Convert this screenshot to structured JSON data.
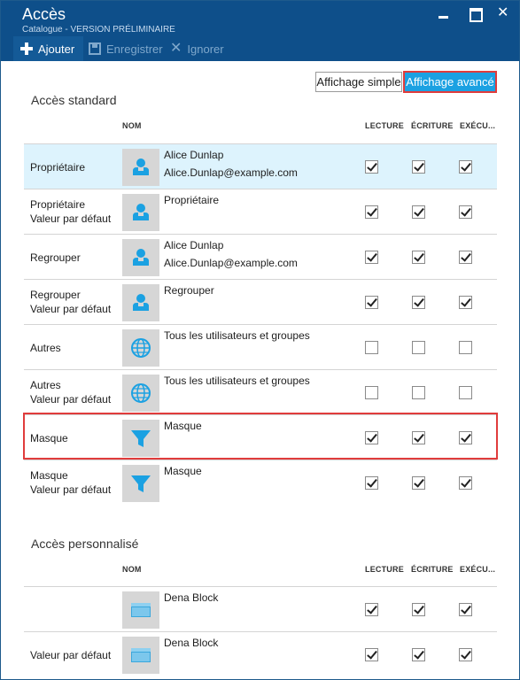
{
  "window": {
    "title": "Accès",
    "subtitle": "Catalogue - VERSION PRÉLIMINAIRE"
  },
  "toolbar": {
    "add_label": "Ajouter",
    "save_label": "Enregistrer",
    "ignore_label": "Ignorer"
  },
  "view_switch": {
    "simple": "Affichage simple",
    "advanced": "Affichage avancé"
  },
  "columns": {
    "name": "NOM",
    "read": "LECTURE",
    "write": "ÉCRITURE",
    "exec": "EXÉCU..."
  },
  "standard": {
    "title": "Accès standard",
    "rows": [
      {
        "label1": "Propriétaire",
        "label2": "",
        "icon": "user-icon",
        "name1": "Alice Dunlap",
        "name2": "Alice.Dunlap@example.com",
        "read": true,
        "write": true,
        "exec": true,
        "selected": true
      },
      {
        "label1": "Propriétaire",
        "label2": "Valeur par défaut",
        "icon": "user-icon",
        "name1": "Propriétaire",
        "name2": "",
        "read": true,
        "write": true,
        "exec": true
      },
      {
        "label1": "Regrouper",
        "label2": "",
        "icon": "user-icon",
        "name1": "Alice Dunlap",
        "name2": "Alice.Dunlap@example.com",
        "read": true,
        "write": true,
        "exec": true
      },
      {
        "label1": "Regrouper",
        "label2": "Valeur par défaut",
        "icon": "user-icon",
        "name1": "Regrouper",
        "name2": "",
        "read": true,
        "write": true,
        "exec": true
      },
      {
        "label1": "Autres",
        "label2": "",
        "icon": "globe-icon",
        "name1": "Tous les utilisateurs et groupes",
        "name2": "",
        "read": false,
        "write": false,
        "exec": false
      },
      {
        "label1": "Autres",
        "label2": "Valeur par défaut",
        "icon": "globe-icon",
        "name1": "Tous les utilisateurs et groupes",
        "name2": "",
        "read": false,
        "write": false,
        "exec": false
      },
      {
        "label1": "Masque",
        "label2": "",
        "icon": "filter-icon",
        "name1": "Masque",
        "name2": "",
        "read": true,
        "write": true,
        "exec": true
      },
      {
        "label1": "Masque",
        "label2": "Valeur par défaut",
        "icon": "filter-icon",
        "name1": "Masque",
        "name2": "",
        "read": true,
        "write": true,
        "exec": true
      }
    ]
  },
  "custom": {
    "title": "Accès personnalisé",
    "rows": [
      {
        "label1": "",
        "label2": "",
        "icon": "window-icon",
        "name1": "Dena Block",
        "name2": "",
        "read": true,
        "write": true,
        "exec": true
      },
      {
        "label1": "Valeur par défaut",
        "label2": "",
        "icon": "window-icon",
        "name1": "Dena Block",
        "name2": "",
        "read": true,
        "write": true,
        "exec": true
      }
    ]
  },
  "colors": {
    "header": "#0e4f8a",
    "accent": "#1ba1e2",
    "selected_row": "#ddf3fd",
    "highlight": "#e03c3c"
  }
}
